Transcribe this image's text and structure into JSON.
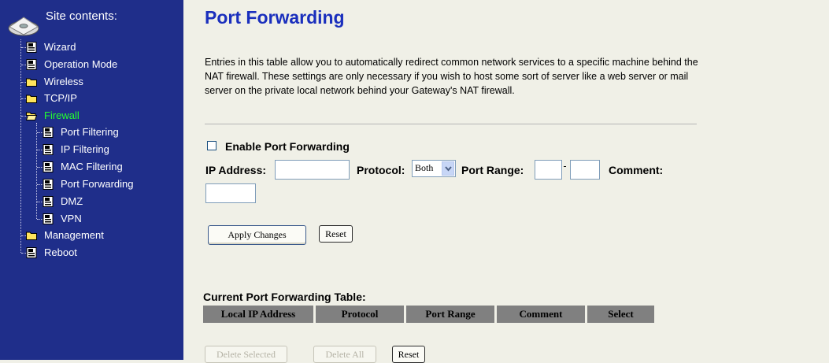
{
  "sidebar": {
    "title": "Site contents:",
    "items": [
      {
        "label": "Wizard",
        "icon": "page-icon"
      },
      {
        "label": "Operation Mode",
        "icon": "page-icon"
      },
      {
        "label": "Wireless",
        "icon": "folder-icon"
      },
      {
        "label": "TCP/IP",
        "icon": "folder-icon"
      },
      {
        "label": "Firewall",
        "icon": "folder-open-icon",
        "active": true
      },
      {
        "label": "Port Filtering",
        "icon": "page-icon"
      },
      {
        "label": "IP Filtering",
        "icon": "page-icon"
      },
      {
        "label": "MAC Filtering",
        "icon": "page-icon"
      },
      {
        "label": "Port Forwarding",
        "icon": "page-icon"
      },
      {
        "label": "DMZ",
        "icon": "page-icon"
      },
      {
        "label": "VPN",
        "icon": "page-icon"
      },
      {
        "label": "Management",
        "icon": "folder-icon"
      },
      {
        "label": "Reboot",
        "icon": "page-icon"
      }
    ]
  },
  "main": {
    "title": "Port Forwarding",
    "intro": "Entries in this table allow you to automatically redirect common network services to a specific machine behind the NAT firewall. These settings are only necessary if you wish to host some sort of server like a web server or mail server on the private local network behind your Gateway's NAT firewall.",
    "enable_label": "Enable Port Forwarding",
    "enable_checked": false,
    "form": {
      "ip_label": "IP Address:",
      "ip_value": "",
      "protocol_label": "Protocol:",
      "protocol_value": "Both",
      "range_label": "Port Range:",
      "range_from": "",
      "range_to": "",
      "comment_label": "Comment:",
      "comment_value": ""
    },
    "buttons": {
      "apply": "Apply Changes",
      "reset": "Reset"
    },
    "table": {
      "title": "Current Port Forwarding Table:",
      "columns": [
        "Local IP Address",
        "Protocol",
        "Port Range",
        "Comment",
        "Select"
      ]
    },
    "table_buttons": {
      "delete_selected": "Delete Selected",
      "delete_all": "Delete All",
      "reset": "Reset"
    }
  },
  "colors": {
    "sidebar_bg": "#1f2e8a",
    "active_item": "#23ff2e",
    "title": "#1a2fbd",
    "page_bg": "#f0f0e7",
    "table_header": "#808080"
  }
}
